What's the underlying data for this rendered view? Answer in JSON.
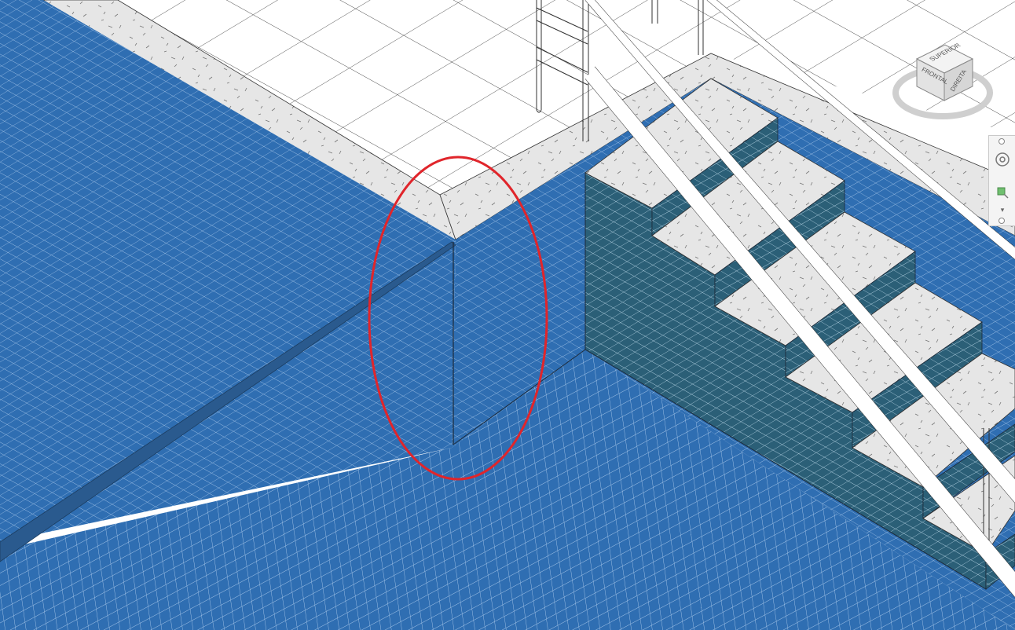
{
  "viewcube": {
    "face_top": "SUPERIOR",
    "face_front": "FRONTAL",
    "face_right": "DIREITA",
    "icon": "viewcube-icon"
  },
  "navigation_bar": {
    "steering_wheel_icon": "steering-wheel-icon",
    "zoom_icon": "zoom-extents-icon"
  },
  "colors": {
    "pool_tile": "#2f6eb2",
    "pool_tile_grout": "#a9c8ea",
    "wall_tile_dark": "#2b5f77",
    "coping": "#e6e6e6",
    "deck": "#ffffff",
    "highlight": "#e0252b"
  }
}
